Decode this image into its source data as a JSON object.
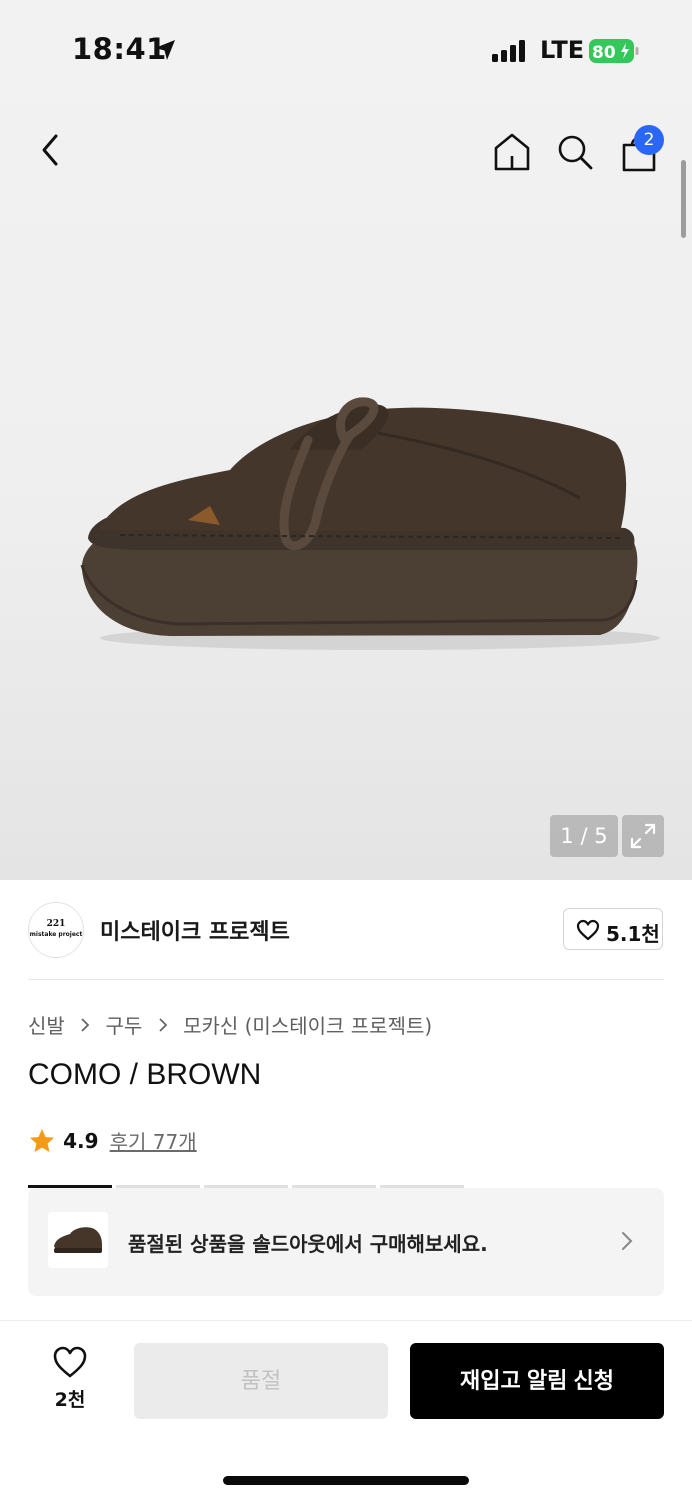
{
  "status_bar": {
    "time": "18:41",
    "network": "LTE",
    "battery": "80",
    "battery_color": "#34c759"
  },
  "nav": {
    "cart_count": "2",
    "badge_color": "#2b67f6",
    "icons": [
      "back-icon",
      "home-icon",
      "search-icon",
      "shopping-bag-icon"
    ]
  },
  "gallery": {
    "pager": "1 / 5",
    "image_alt": "brown suede shoe"
  },
  "brand": {
    "logo_top": "221",
    "logo_bottom": "mistake project",
    "name": "미스테이크 프로젝트",
    "likes": "5.1천"
  },
  "breadcrumb": {
    "items": [
      "신발",
      "구두",
      "모카신 (미스테이크 프로젝트)"
    ]
  },
  "product": {
    "title": "COMO / BROWN",
    "rating": "4.9",
    "reviews": "후기 77개",
    "star_color": "#f59a16"
  },
  "soldout_banner": {
    "message": "품절된 상품을 솔드아웃에서 구매해보세요."
  },
  "bottom_bar": {
    "wish_count": "2천",
    "sold_out_label": "품절",
    "restock_label": "재입고 알림 신청"
  }
}
